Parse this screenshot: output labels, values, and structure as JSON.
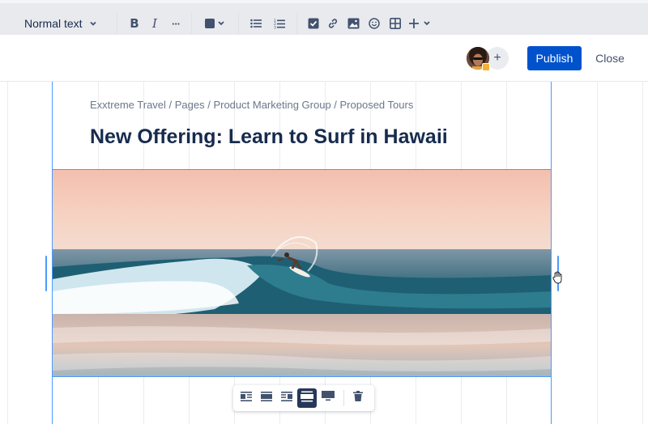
{
  "toolbar": {
    "text_style": "Normal text",
    "publish_label": "Publish",
    "close_label": "Close",
    "bold_label": "B",
    "italic_label": "I",
    "more_label": "···",
    "add_label": "+",
    "add_collaborator_label": "+"
  },
  "page": {
    "breadcrumb": "Exxtreme Travel / Pages / Product Marketing Group / Proposed Tours",
    "title": "New Offering: Learn to Surf in Hawaii"
  },
  "colors": {
    "primary": "#0052cc",
    "selection": "#4c9aff",
    "text": "#172b4d",
    "muted": "#6b778c"
  },
  "icons": {
    "text_color": "text-color-icon",
    "bullet_list": "bullet-list-icon",
    "numbered_list": "numbered-list-icon",
    "action_item": "checkbox-icon",
    "link": "link-icon",
    "image": "image-icon",
    "emoji": "emoji-icon",
    "table": "table-icon",
    "insert": "plus-icon",
    "delete": "trash-icon"
  }
}
